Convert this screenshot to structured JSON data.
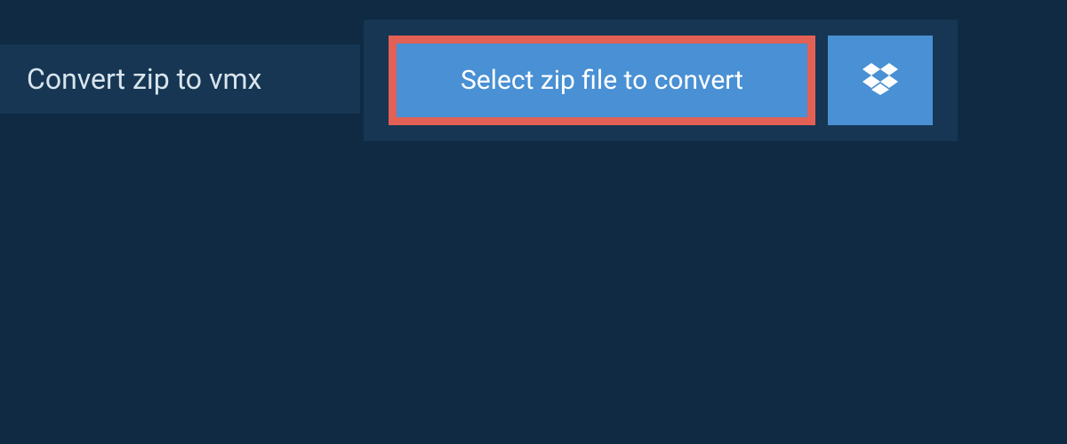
{
  "header": {
    "title": "Convert zip to vmx"
  },
  "actions": {
    "select_file_label": "Select zip file to convert",
    "dropbox_icon": "dropbox-icon"
  },
  "colors": {
    "page_bg": "#0f2a42",
    "panel_bg": "#163653",
    "button_bg": "#4990d4",
    "highlight_border": "#e36055",
    "text_light": "#d8e4ed",
    "text_white": "#ffffff"
  }
}
